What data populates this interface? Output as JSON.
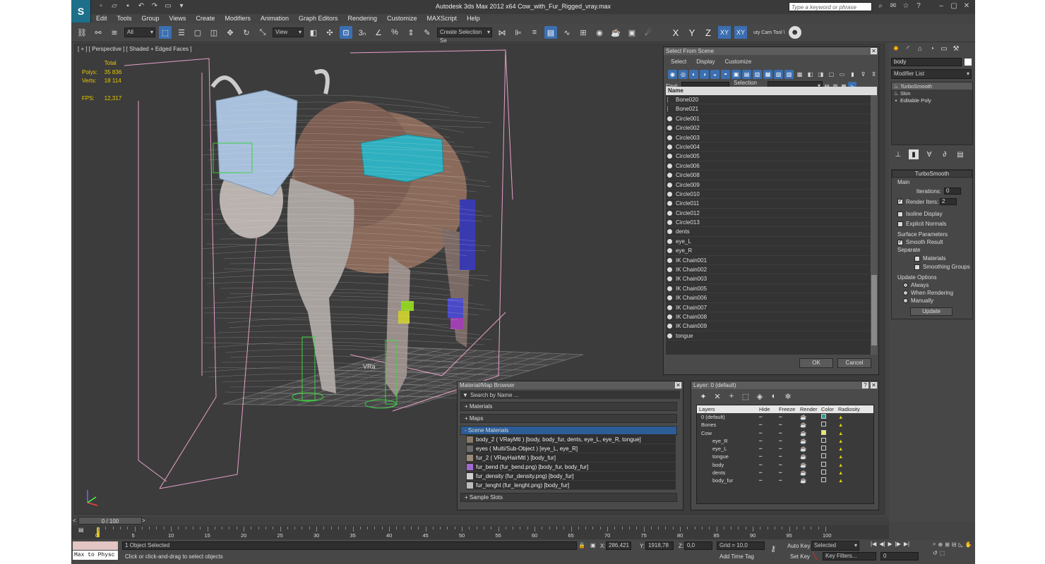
{
  "app": {
    "logo": "S",
    "title": "Autodesk 3ds Max  2012 x64      Cow_with_Fur_Rigged_vray.max",
    "search_placeholder": "Type a keyword or phrase"
  },
  "menu": [
    "Edit",
    "Tools",
    "Group",
    "Views",
    "Create",
    "Modifiers",
    "Animation",
    "Graph Editors",
    "Rendering",
    "Customize",
    "MAXScript",
    "Help"
  ],
  "toolbar": {
    "filter": "All",
    "view": "View",
    "selection_set": "Create Selection Se",
    "axes": [
      "X",
      "Y",
      "Z",
      "XY",
      "XY"
    ],
    "cam_tool": "uty Cam Tool \\"
  },
  "viewport": {
    "label": "[ + ] [ Perspective ] [ Shaded + Edged Faces ]",
    "stats": {
      "header": "Total",
      "polys_label": "Polys:",
      "polys": "35 836",
      "verts_label": "Verts:",
      "verts": "18 114",
      "fps_label": "FPS:",
      "fps": "12,317"
    },
    "vray_label": "VRa"
  },
  "command_panel": {
    "name_field": "body",
    "modifier_list": "Modifier List",
    "stack": [
      "TurboSmooth",
      "Skin",
      "Editable Poly"
    ],
    "turbosmooth": {
      "title": "TurboSmooth",
      "main": "Main",
      "iterations_label": "Iterations:",
      "iterations": "0",
      "render_iters_label": "Render Iters:",
      "render_iters": "2",
      "isoline": "Isoline Display",
      "explicit": "Explicit Normals",
      "surface": "Surface Parameters",
      "smooth_result": "Smooth Result",
      "separate": "Separate",
      "materials": "Materials",
      "smoothing_groups": "Smoothing Groups",
      "update_options": "Update Options",
      "always": "Always",
      "when_rendering": "When Rendering",
      "manually": "Manually",
      "update": "Update"
    }
  },
  "select_from_scene": {
    "title": "Select From Scene",
    "menu": [
      "Select",
      "Display",
      "Customize"
    ],
    "find_label": "Find:",
    "selection_set_label": "Selection Set:",
    "col_name": "Name",
    "items": [
      {
        "name": "Bone020",
        "kind": "bone"
      },
      {
        "name": "Bone021",
        "kind": "bone"
      },
      {
        "name": "Circle001",
        "kind": "shape"
      },
      {
        "name": "Circle002",
        "kind": "shape"
      },
      {
        "name": "Circle003",
        "kind": "shape"
      },
      {
        "name": "Circle004",
        "kind": "shape"
      },
      {
        "name": "Circle005",
        "kind": "shape"
      },
      {
        "name": "Circle006",
        "kind": "shape"
      },
      {
        "name": "Circle008",
        "kind": "shape"
      },
      {
        "name": "Circle009",
        "kind": "shape"
      },
      {
        "name": "Circle010",
        "kind": "shape"
      },
      {
        "name": "Circle011",
        "kind": "shape"
      },
      {
        "name": "Circle012",
        "kind": "shape"
      },
      {
        "name": "Circle013",
        "kind": "shape"
      },
      {
        "name": "dents",
        "kind": "geo"
      },
      {
        "name": "eye_L",
        "kind": "geo"
      },
      {
        "name": "eye_R",
        "kind": "geo"
      },
      {
        "name": "IK Chain001",
        "kind": "shape"
      },
      {
        "name": "IK Chain002",
        "kind": "shape"
      },
      {
        "name": "IK Chain003",
        "kind": "shape"
      },
      {
        "name": "IK Chain005",
        "kind": "shape"
      },
      {
        "name": "IK Chain006",
        "kind": "shape"
      },
      {
        "name": "IK Chain007",
        "kind": "shape"
      },
      {
        "name": "IK Chain008",
        "kind": "shape"
      },
      {
        "name": "IK Chain009",
        "kind": "shape"
      },
      {
        "name": "tongue",
        "kind": "geo"
      }
    ],
    "ok": "OK",
    "cancel": "Cancel"
  },
  "material_browser": {
    "title": "Material/Map Browser",
    "search_placeholder": "Search by Name ...",
    "sections": [
      "+ Materials",
      "+ Maps",
      "- Scene Materials"
    ],
    "materials": [
      {
        "text": "body_2  ( VRayMtl )  [body, body_fur, dents, eye_L, eye_R, tongue]",
        "color": "#8a7a6a"
      },
      {
        "text": "eyes  ( Multi/Sub-Object )  [eye_L, eye_R]",
        "color": "#6a6a6a"
      },
      {
        "text": "fur_2  ( VRayHairMtl )  [body_fur]",
        "color": "#9a8a7a"
      },
      {
        "text": "fur_bend (fur_bend.png) [body_fur, body_fur]",
        "color": "#a06ad0"
      },
      {
        "text": "fur_density (fur_density.png) [body_fur]",
        "color": "#cfcfcf"
      },
      {
        "text": "fur_lenght (fur_lenght.png) [body_fur]",
        "color": "#bcbcbc"
      }
    ],
    "sample_slots": "+ Sample Slots"
  },
  "layers": {
    "title": "Layer: 0 (default)",
    "cols": [
      "Layers",
      "Hide",
      "Freeze",
      "Render",
      "Color",
      "Radiosity"
    ],
    "rows": [
      {
        "name": "0 (default)",
        "indent": 0,
        "color": "#2f9b89"
      },
      {
        "name": "Bones",
        "indent": 0,
        "color": "#3b3b3b"
      },
      {
        "name": "Cow",
        "indent": 0,
        "color": "#e8e86a"
      },
      {
        "name": "eye_R",
        "indent": 1,
        "color": "#3b3b3b"
      },
      {
        "name": "eye_L",
        "indent": 1,
        "color": "#3b3b3b"
      },
      {
        "name": "tongue",
        "indent": 1,
        "color": "#3b3b3b"
      },
      {
        "name": "body",
        "indent": 1,
        "color": "#3b3b3b"
      },
      {
        "name": "dents",
        "indent": 1,
        "color": "#3b3b3b"
      },
      {
        "name": "body_fur",
        "indent": 1,
        "color": "#3b3b3b"
      }
    ]
  },
  "timeline": {
    "frame": "0 / 100",
    "ticks": [
      "0",
      "5",
      "10",
      "15",
      "20",
      "25",
      "30",
      "35",
      "40",
      "45",
      "50",
      "55",
      "60",
      "65",
      "70",
      "75",
      "80",
      "85",
      "90",
      "95",
      "100"
    ]
  },
  "status": {
    "script": "Max to Physc",
    "selected": "1 Object Selected",
    "prompt": "Click or click-and-drag to select objects",
    "x_label": "X:",
    "x": "286,421",
    "y_label": "Y:",
    "y": "1918,78",
    "z_label": "Z:",
    "z": "0,0",
    "grid": "Grid = 10,0",
    "add_time_tag": "Add Time Tag",
    "auto_key": "Auto Key",
    "set_key": "Set Key",
    "selected_dd": "Selected",
    "key_filters": "Key Filters...",
    "frame_field": "0"
  }
}
